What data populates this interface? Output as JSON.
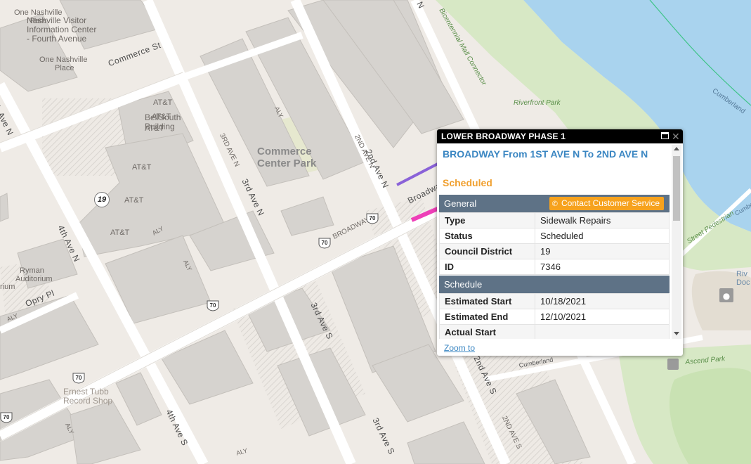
{
  "map": {
    "labels": {
      "one_nashville_place_top": "One Nashville",
      "place_small": "Place",
      "visitor_center_1": "Nashville Visitor",
      "visitor_center_2": "Information Center",
      "visitor_center_3": "- Fourth Avenue",
      "one_nashville_place_2a": "One Nashville",
      "one_nashville_place_2b": "Place",
      "commerce_st": "Commerce St",
      "att_1": "AT&T",
      "att_2": "AT&T",
      "att_3": "AT&T",
      "att_4": "AT&T",
      "att_5": "AT&T",
      "att_6": "AT&T",
      "att_building_1": "BellSouth",
      "att_building_2": "Building",
      "commerce_center_park_1": "Commerce",
      "commerce_center_park_2": "Center Park",
      "third_ave_n_a": "3rd Ave N",
      "third_ave_n_b": "3RD AVE N",
      "second_ave_n_a": "2nd Ave N",
      "second_ave_n_b": "2ND AVE N",
      "fourth_ave_n": "4th Ave N",
      "broadway_a": "Broadway",
      "broadway_b": "BROADWAY",
      "ryman_1": "Ryman",
      "ryman_2": "Auditorium",
      "rium": "rium",
      "opry_pl": "Opry Pl",
      "third_ave_s": "3rd Ave S",
      "third_ave_s_b": "3rd Ave S",
      "fourth_ave_s": "4th Ave S",
      "second_ave_s": "2ND AVE S",
      "second_ave_s_b": "2nd Ave S",
      "ernest_tubb_1": "Ernest Tubb",
      "ernest_tubb_2": "Record Shop",
      "riverfront_park": "Riverfront Park",
      "bicentennial_mall": "Bicentennial Mall Connector",
      "cumberland_top": "Cumberland",
      "cumberland_mid": "Cumberla",
      "cumberland_low": "Cumberland",
      "street_pedestrian": "Street Pedestrian",
      "riv": "Riv",
      "doc": "Doc",
      "ascend_park": "Ascend Park",
      "aly_1": "ALY",
      "aly_2": "ALY",
      "aly_3": "ALY",
      "aly_4": "ALY",
      "aly_5": "ALY",
      "aly_6": "ALY",
      "eh_ave_n": "h Ave N",
      "n_top": "N"
    },
    "route_shields": [
      "70",
      "70",
      "70",
      "70",
      "70",
      "70"
    ],
    "council_district_marker": "19",
    "colors": {
      "water": "#a9d3ee",
      "park": "#d7e8c5",
      "building": "#d6d3cf",
      "road": "#ffffff",
      "highlight_pink": "#ee3fb8",
      "highlight_purple": "#8a62d8"
    }
  },
  "popup": {
    "header_title": "LOWER BROADWAY PHASE 1",
    "title": "BROADWAY From 1ST AVE N To 2ND AVE N",
    "status": "Scheduled",
    "general_section": "General",
    "contact_button": "Contact Customer Service",
    "general_rows": [
      {
        "key": "Type",
        "value": "Sidewalk Repairs"
      },
      {
        "key": "Status",
        "value": "Scheduled"
      },
      {
        "key": "Council District",
        "value": "19"
      },
      {
        "key": "ID",
        "value": "7346"
      }
    ],
    "schedule_section": "Schedule",
    "schedule_rows": [
      {
        "key": "Estimated Start",
        "value": "10/18/2021"
      },
      {
        "key": "Estimated End",
        "value": "12/10/2021"
      },
      {
        "key": "Actual Start",
        "value": ""
      }
    ],
    "zoom_link": "Zoom to"
  }
}
